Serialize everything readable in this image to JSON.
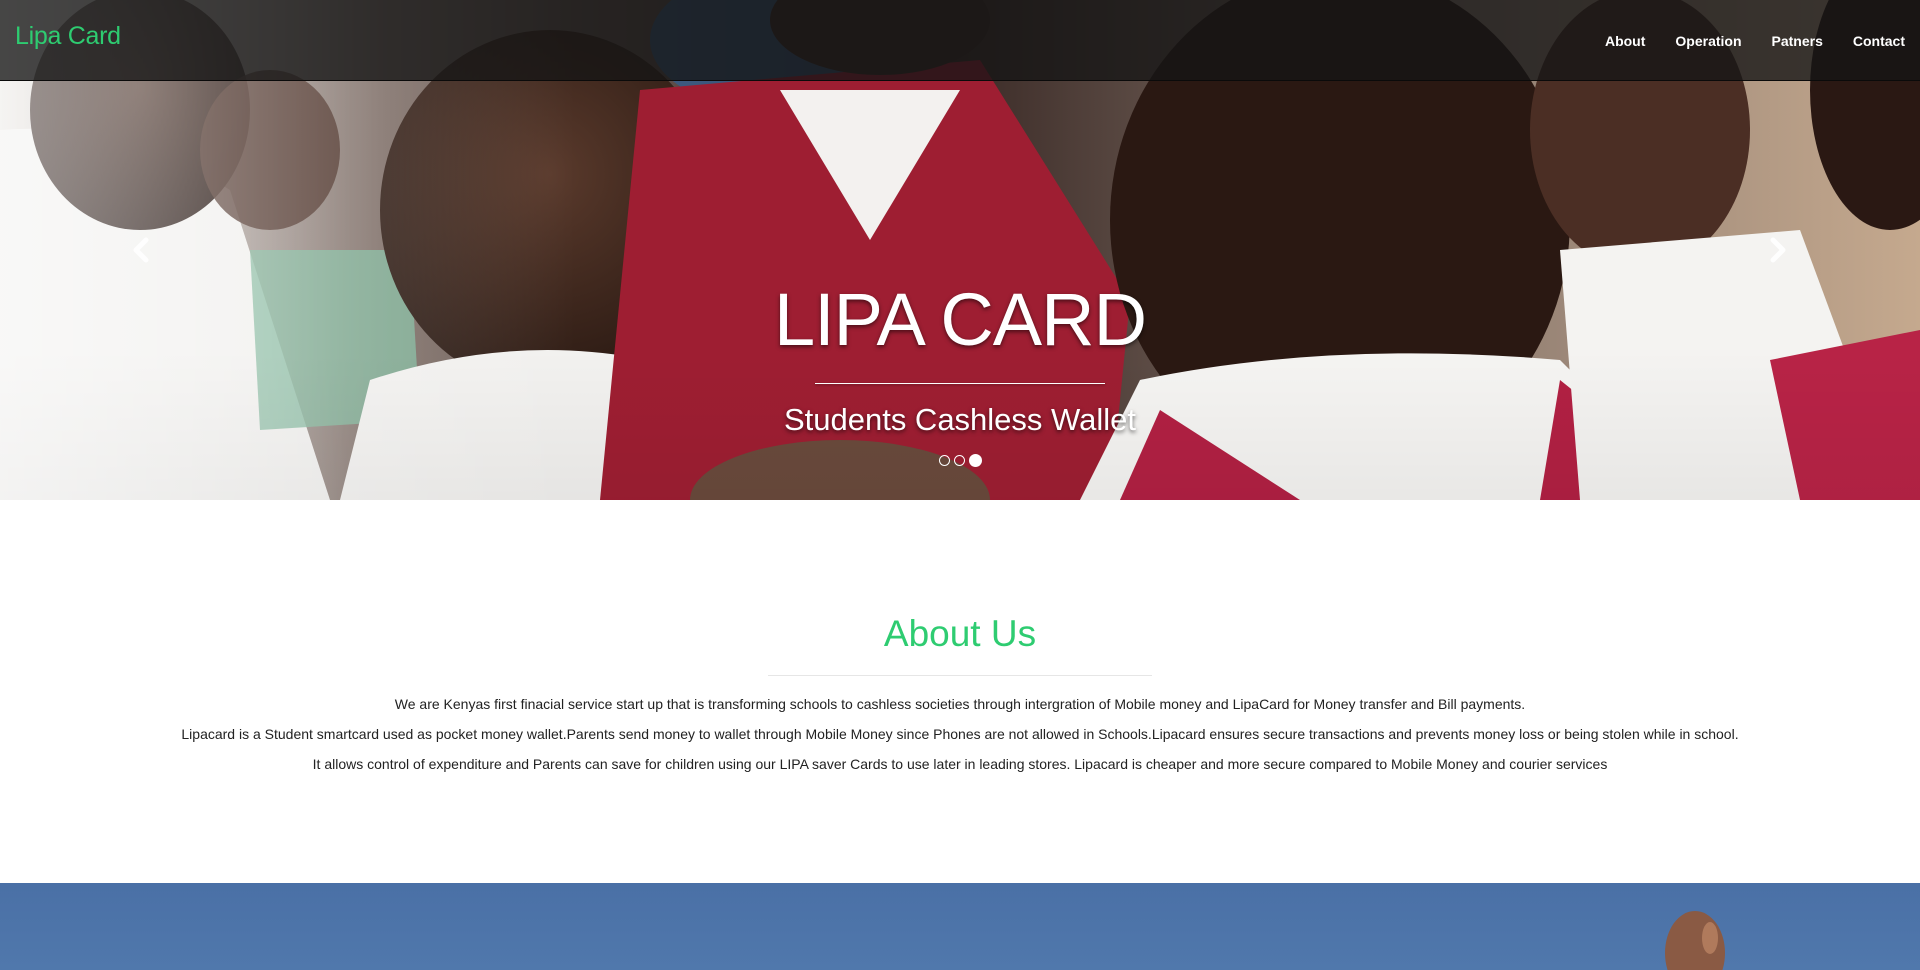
{
  "navbar": {
    "brand": "Lipa Card",
    "links": [
      {
        "label": "About"
      },
      {
        "label": "Operation"
      },
      {
        "label": "Patners"
      },
      {
        "label": "Contact"
      }
    ]
  },
  "hero": {
    "title": "LIPA CARD",
    "subtitle": "Students Cashless Wallet",
    "slides_total": 3,
    "active_slide": 3
  },
  "about": {
    "title": "About Us",
    "paragraphs": [
      "We are Kenyas first finacial service start up that is transforming schools to cashless societies through intergration of Mobile money and LipaCard for Money transfer and Bill payments.",
      "Lipacard is a Student smartcard used as pocket money wallet.Parents send money to wallet through Mobile Money since Phones are not allowed in Schools.Lipacard ensures secure transactions and prevents money loss or being stolen while in school.",
      "It allows control of expenditure and Parents can save for children using our LIPA saver Cards to use later in leading stores. Lipacard is cheaper and more secure compared to Mobile Money and courier services"
    ]
  },
  "colors": {
    "brand_green": "#2ecc71",
    "navbar_bg": "#141414",
    "bottom_band_blue": "#4a70a6"
  },
  "icons": {
    "prev": "chevron-left-icon",
    "next": "chevron-right-icon"
  }
}
